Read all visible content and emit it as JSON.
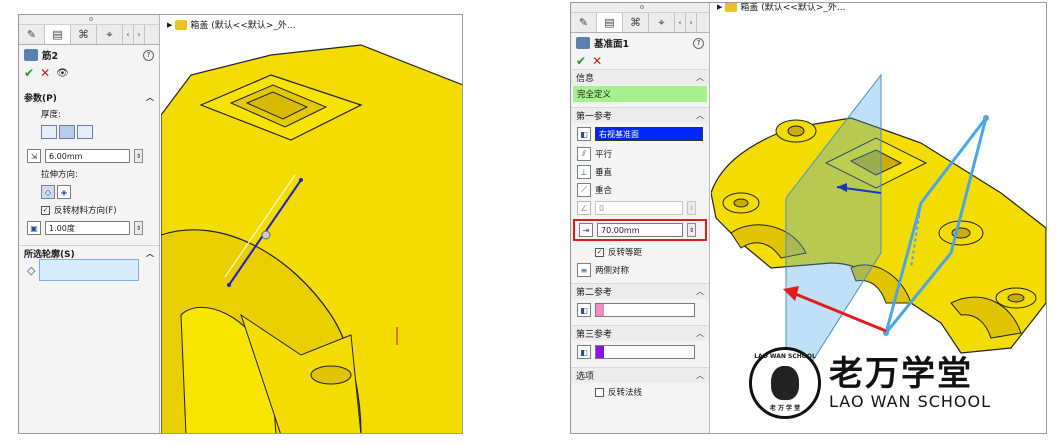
{
  "left": {
    "tabs": [
      "features-icon",
      "property-icon",
      "config-icon",
      "display-icon",
      "left-arrow",
      "right-arrow"
    ],
    "feature_title": "筋2",
    "params_section": "参数(P)",
    "thickness_label": "厚度:",
    "thickness_value": "6.00mm",
    "extrude_dir_label": "拉伸方向:",
    "flip_material_label": "反转材料方向(F)",
    "draft_value": "1.00度",
    "contour_section": "所选轮廓(S)",
    "tree_label": "箱盖 (默认<<默认>_外..."
  },
  "right": {
    "tabs": [
      "features-icon",
      "property-icon",
      "config-icon",
      "display-icon",
      "left-arrow",
      "right-arrow"
    ],
    "feature_title": "基准面1",
    "info_section": "信息",
    "status_text": "完全定义",
    "first_ref_section": "第一参考",
    "first_ref_value": "右视基准面",
    "opt_parallel": "平行",
    "opt_perpendicular": "垂直",
    "opt_coincident": "重合",
    "angle_value": "0",
    "offset_value": "70.00mm",
    "flip_offset_label": "反转等距",
    "symmetric_label": "两侧对称",
    "second_ref_section": "第二参考",
    "third_ref_section": "第三参考",
    "options_section": "选项",
    "flip_normal_label": "反转法线",
    "tree_label": "箱盖 (默认<<默认>_外...",
    "logo_cn": "老万学堂",
    "logo_en": "LAO WAN SCHOOL",
    "logo_ring_top": "LAO WAN SCHOOL",
    "logo_ring_bottom": "老 万 学 堂"
  },
  "colors": {
    "part_yellow": "#f3dc00",
    "status_green": "#a6f08e",
    "ref1_blue": "#0026ff",
    "ref2_pink": "#f58ac0",
    "ref3_purple": "#8b14e8",
    "plane_blue": "#4aa6e8",
    "highlight_red": "#e31b1b"
  }
}
